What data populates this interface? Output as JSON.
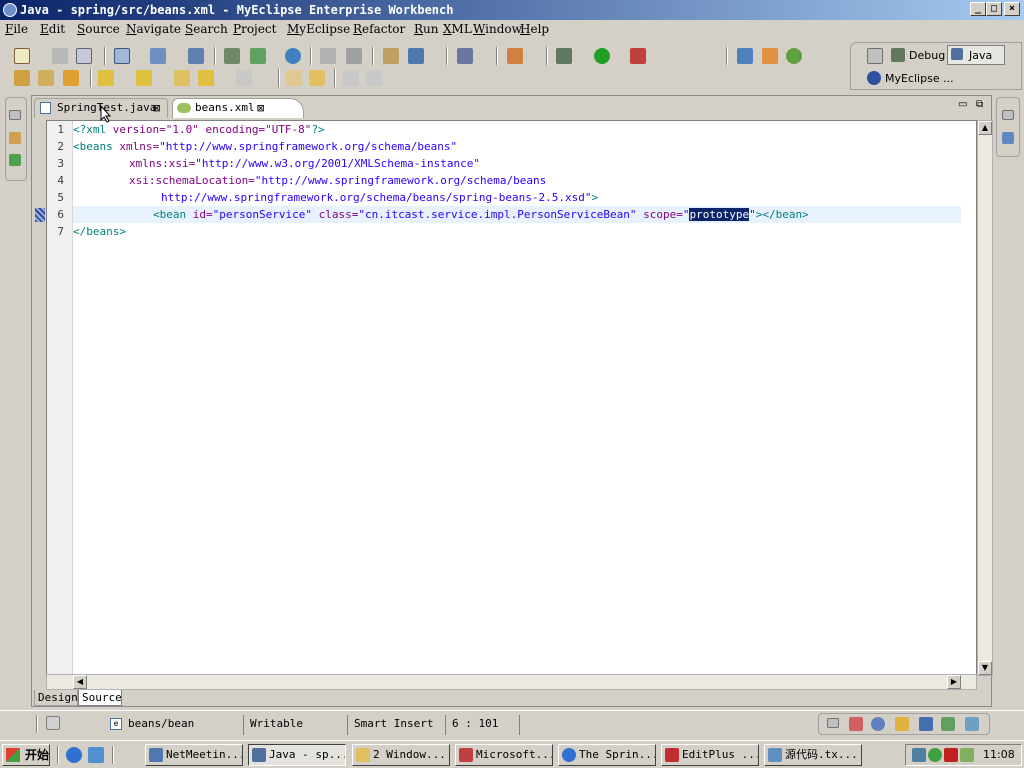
{
  "window": {
    "title": "Java - spring/src/beans.xml - MyEclipse Enterprise Workbench",
    "minimize": "_",
    "maximize": "□",
    "close": "×"
  },
  "menu": [
    "File",
    "Edit",
    "Source",
    "Navigate",
    "Search",
    "Project",
    "MyEclipse",
    "Refactor",
    "Run",
    "XML",
    "Window",
    "Help"
  ],
  "perspectives": {
    "debug": "Debug",
    "java": "Java",
    "myeclipse": "MyEclipse ..."
  },
  "editor": {
    "tabs": [
      {
        "label": "SpringTest.java",
        "active": false
      },
      {
        "label": "beans.xml",
        "active": true
      }
    ],
    "lines": [
      "1",
      "2",
      "3",
      "4",
      "5",
      "6",
      "7"
    ],
    "code": {
      "l1_pi_open": "<?xml",
      "l1_attrs": " version=\"1.0\" encoding=\"UTF-8\"",
      "l1_pi_close": "?>",
      "l2_tag": "<beans",
      "l2_attr": " xmlns=",
      "l2_val": "\"http://www.springframework.org/schema/beans\"",
      "l3_attr": "xmlns:xsi=",
      "l3_val": "\"http://www.w3.org/2001/XMLSchema-instance\"",
      "l4_attr": "xsi:schemaLocation=",
      "l4_val": "\"http://www.springframework.org/schema/beans",
      "l5_val": "http://www.springframework.org/schema/beans/spring-beans-2.5.xsd\"",
      "l5_tag": ">",
      "l6_tag_open": "<bean",
      "l6_id_attr": " id=",
      "l6_id_val": "\"personService\"",
      "l6_class_attr": " class=",
      "l6_class_val": "\"cn.itcast.service.impl.PersonServiceBean\"",
      "l6_scope_attr": " scope=",
      "l6_scope_q1": "\"",
      "l6_scope_val": "prototype",
      "l6_scope_q2": "\"",
      "l6_tag_close": "></bean>",
      "l7_tag": "</beans>"
    },
    "bottom_tabs": {
      "design": "Design",
      "source": "Source"
    }
  },
  "status": {
    "path": "beans/bean",
    "mode": "Writable",
    "insert": "Smart Insert",
    "position": "6 : 101"
  },
  "taskbar": {
    "start": "开始",
    "tasks": [
      "NetMeetin...",
      "Java - sp...",
      "2 Window...",
      "Microsoft...",
      "The Sprin...",
      "EditPlus ...",
      "源代码.tx..."
    ],
    "clock": "11:08"
  }
}
